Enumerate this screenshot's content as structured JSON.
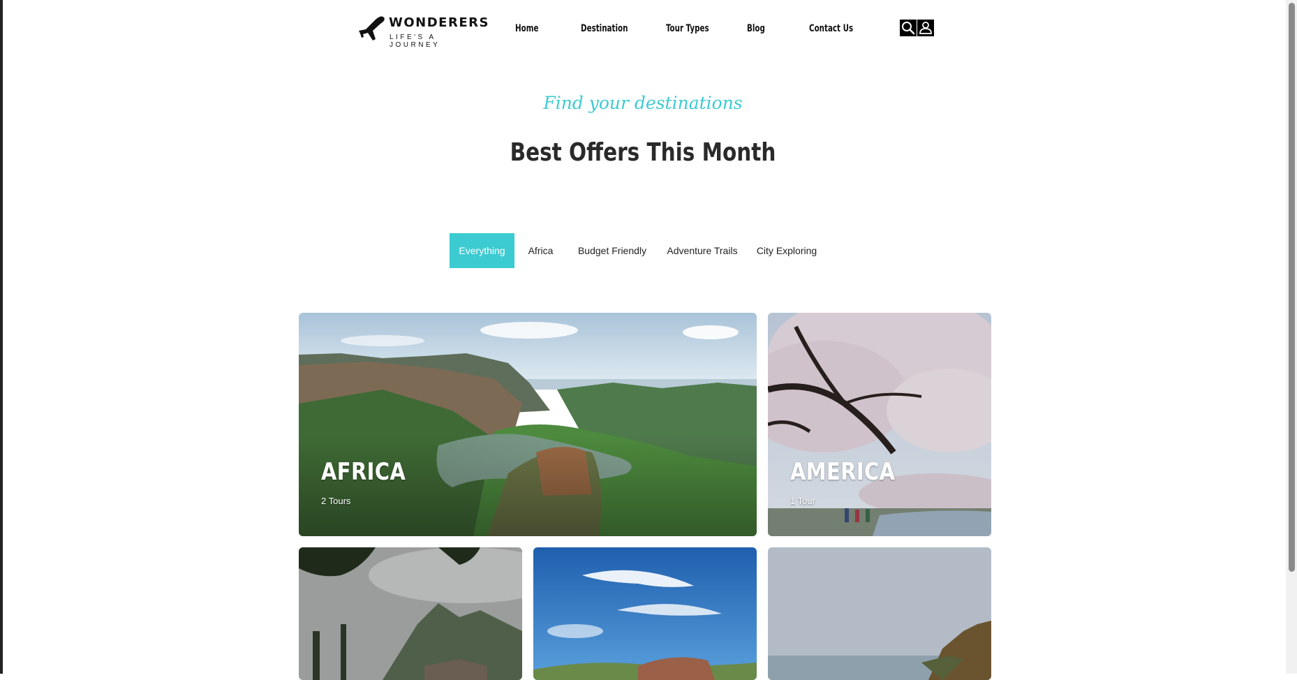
{
  "brand": {
    "name": "WONDERERS",
    "tagline": "LIFE'S A JOURNEY",
    "logo_icon": "airplane-icon"
  },
  "nav": {
    "items": [
      {
        "label": "Home"
      },
      {
        "label": "Destination"
      },
      {
        "label": "Tour Types"
      },
      {
        "label": "Blog"
      },
      {
        "label": "Contact Us"
      }
    ],
    "search_icon": "search-icon",
    "user_icon": "user-icon"
  },
  "section": {
    "subtitle": "Find your destinations",
    "title": "Best Offers This Month"
  },
  "filters": {
    "active": "Everything",
    "items": [
      {
        "label": "Everything"
      },
      {
        "label": "Africa"
      },
      {
        "label": "Budget Friendly"
      },
      {
        "label": "Adventure Trails"
      },
      {
        "label": "City Exploring"
      }
    ]
  },
  "destinations": [
    {
      "name": "AFRICA",
      "count": "2 Tours"
    },
    {
      "name": "AMERICA",
      "count": "1 Tour"
    }
  ],
  "colors": {
    "accent": "#3ccbd1",
    "text": "#222222",
    "background": "#ffffff"
  }
}
